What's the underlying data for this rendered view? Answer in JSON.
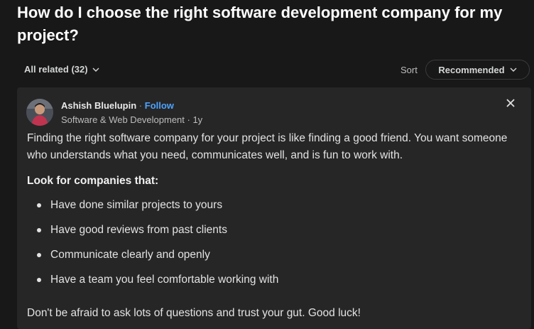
{
  "question": {
    "title": "How do I choose the right software development company for my project?"
  },
  "filters": {
    "all_related_label": "All related (32)",
    "sort_label": "Sort",
    "sort_selected": "Recommended"
  },
  "answer": {
    "author_name": "Ashish Bluelupin",
    "separator": "·",
    "follow_label": "Follow",
    "author_meta": "Software & Web Development · 1y",
    "intro": "Finding the right software company for your project is like finding a good friend. You want someone who understands what you need, communicates well, and is fun to work with.",
    "heading": "Look for companies that:",
    "bullets": [
      "Have done similar projects to yours",
      "Have good reviews from past clients",
      "Communicate clearly and openly",
      "Have a team you feel comfortable working with"
    ],
    "closing": "Don't be afraid to ask lots of questions and trust your gut. Good luck!"
  },
  "colors": {
    "background": "#181818",
    "card": "#262626",
    "link": "#4da3ff",
    "text": "#e3e3e3"
  },
  "icons": [
    "chevron-down-icon",
    "close-icon",
    "avatar"
  ]
}
